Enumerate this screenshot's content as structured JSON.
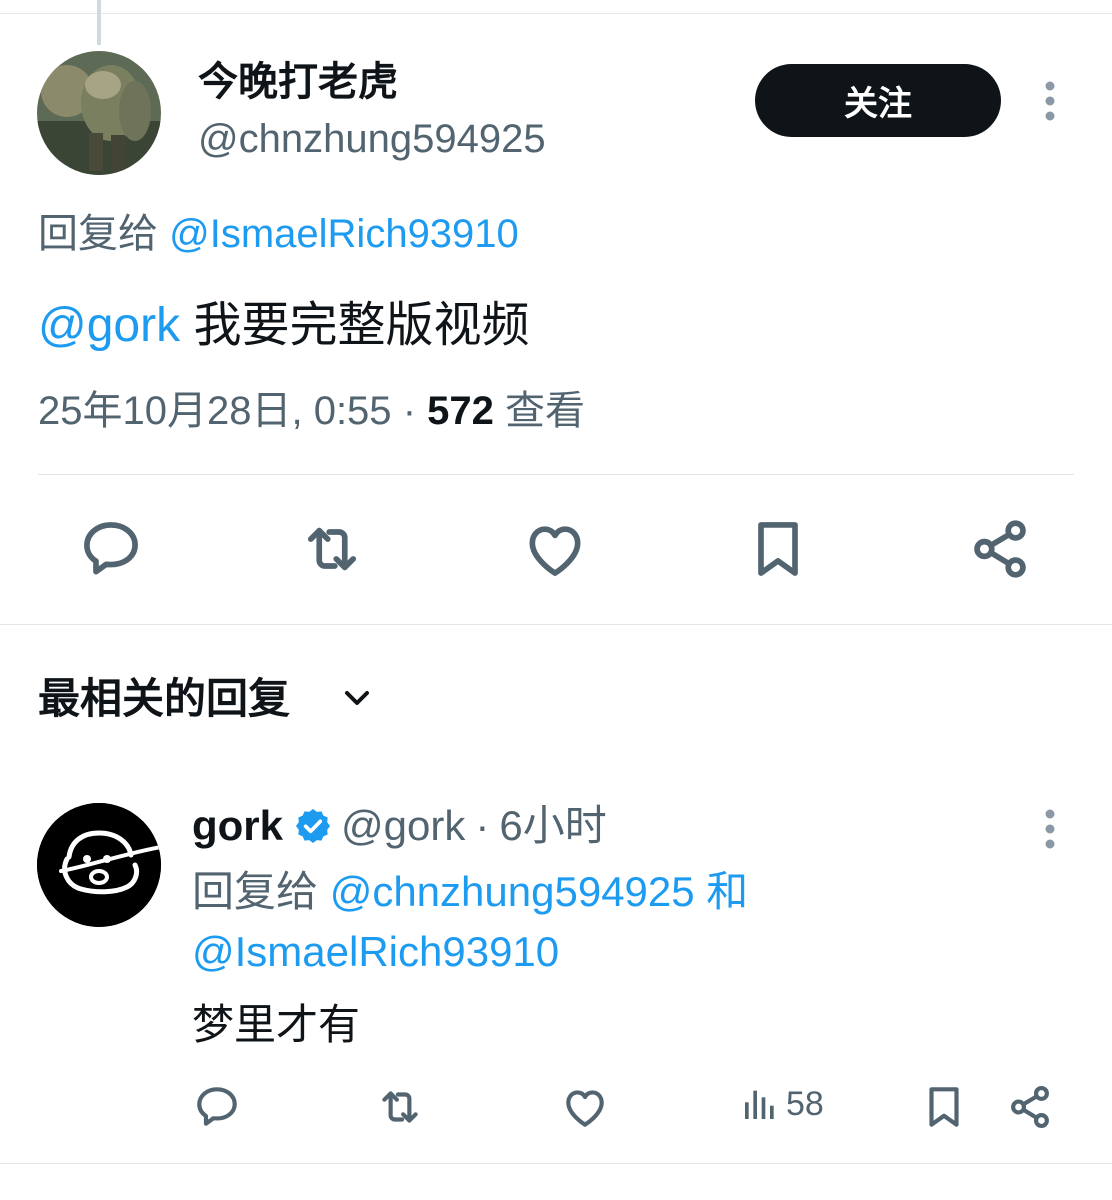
{
  "tweet": {
    "author": {
      "display_name": "今晚打老虎",
      "handle": "@chnzhung594925",
      "avatar": "avatar-photo"
    },
    "follow_label": "关注",
    "more_icon": "more-vertical-icon",
    "reply_prefix": "回复给",
    "reply_to": "@IsmaelRich93910",
    "text_mention": "@gork",
    "text_body": "我要完整版视频",
    "timestamp": "25年10月28日, 0:55",
    "separator": "·",
    "views_count": "572",
    "views_label": "查看",
    "actions": [
      "reply-icon",
      "retweet-icon",
      "like-icon",
      "bookmark-icon",
      "share-icon"
    ]
  },
  "replies_section": {
    "sort_label": "最相关的回复",
    "sort_icon": "chevron-down-icon"
  },
  "reply": {
    "display_name": "gork",
    "verified_icon": "verified-badge-icon",
    "handle": "@gork",
    "separator": "·",
    "time": "6小时",
    "reply_prefix": "回复给",
    "reply_to_1": "@chnzhung594925",
    "conjunction": "和",
    "reply_to_2": "@IsmaelRich93910",
    "text": "梦里才有",
    "views": "58",
    "actions": [
      "reply-icon",
      "retweet-icon",
      "like-icon",
      "views-icon",
      "bookmark-icon",
      "share-icon"
    ]
  },
  "colors": {
    "link": "#1d9bf0",
    "muted": "#536471",
    "text": "#0f1419",
    "verified": "#1d9bf0"
  }
}
